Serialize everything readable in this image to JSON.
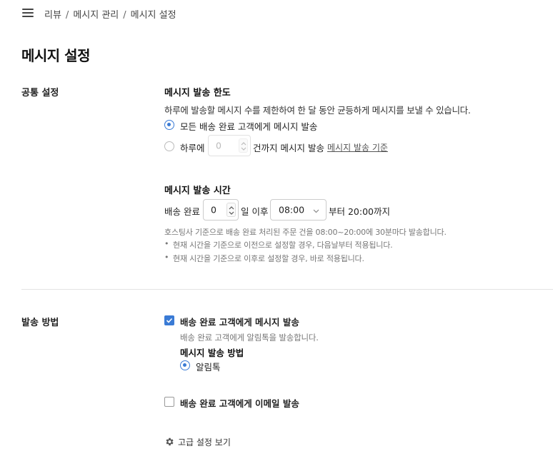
{
  "header": {
    "breadcrumb": [
      "리뷰",
      "메시지 관리",
      "메시지 설정"
    ],
    "separator": "/",
    "menu_icon": "hamburger-menu-icon"
  },
  "page_title": "메시지 설정",
  "common_settings": {
    "label": "공통 설정",
    "limit": {
      "title": "메시지 발송 한도",
      "description": "하루에 발송할 메시지 수를 제한하여 한 달 동안 균등하게 메시지를 보낼 수 있습니다.",
      "option_all": "모든 배송 완료 고객에게 메시지 발송",
      "option_daily_prefix": "하루에",
      "option_daily_value": "0",
      "option_daily_suffix": "건까지 메시지 발송",
      "criteria_link": "메시지 발송 기준",
      "selected": "all"
    },
    "send_time": {
      "title": "메시지 발송 시간",
      "prefix": "배송 완료",
      "days_value": "0",
      "days_suffix": "일 이후",
      "time_value": "08:00",
      "suffix": "부터 20:00까지",
      "note_main": "호스팅사 기준으로 배송 완료 처리된 주문 건을 08:00~20:00에 30분마다 발송합니다.",
      "note_bullets": [
        "현재 시간을 기준으로 이전으로 설정할 경우, 다음날부터 적용됩니다.",
        "현재 시간을 기준으로 이후로 설정할 경우, 바로 적용됩니다."
      ],
      "bullet": "•"
    }
  },
  "send_method": {
    "label": "발송 방법",
    "message_option": {
      "label": "배송 완료 고객에게 메시지 발송",
      "checked": true,
      "description": "배송 완료 고객에게 알림톡을 발송합니다.",
      "method_title": "메시지 발송 방법",
      "method_option": "알림톡"
    },
    "email_option": {
      "label": "배송 완료 고객에게 이메일 발송",
      "checked": false
    },
    "advanced_link": "고급 설정 보기"
  },
  "colors": {
    "accent": "#3a7bd5",
    "divider": "#e4e4e4"
  }
}
